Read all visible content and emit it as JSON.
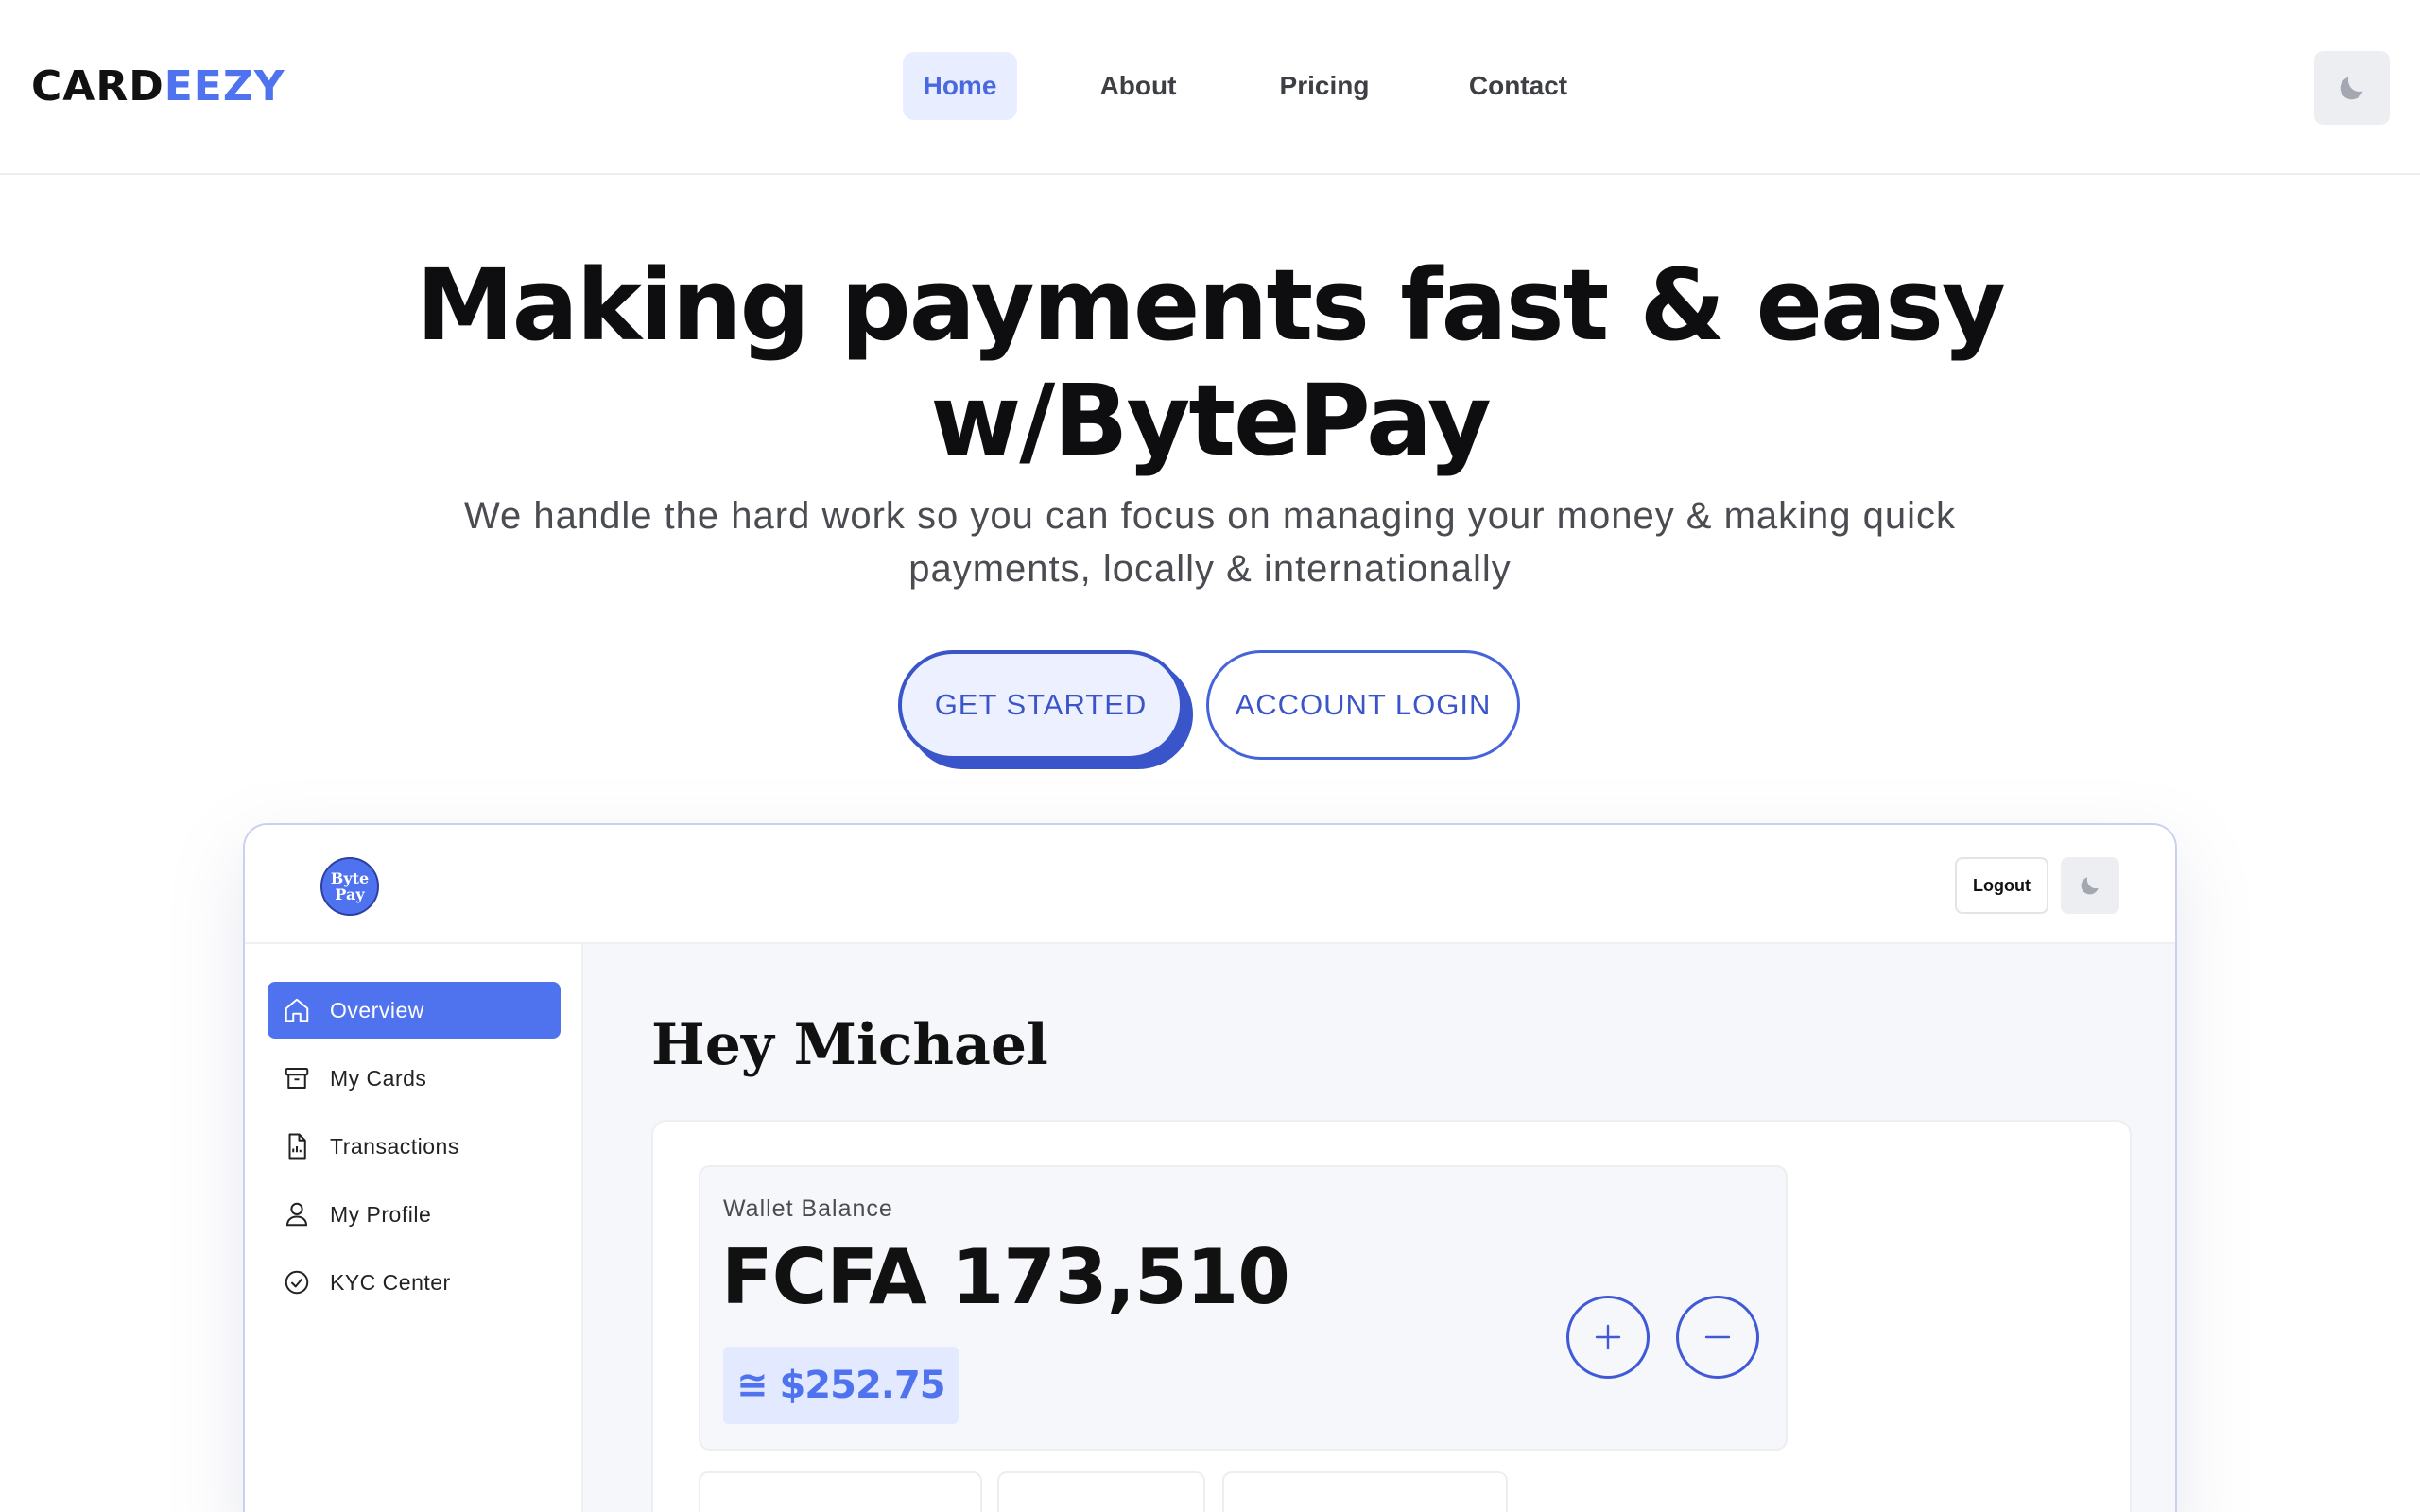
{
  "brand": {
    "part1": "CARD",
    "part2": "EEZY",
    "accent": "#4f72ef"
  },
  "nav": {
    "items": [
      {
        "label": "Home",
        "active": true
      },
      {
        "label": "About",
        "active": false
      },
      {
        "label": "Pricing",
        "active": false
      },
      {
        "label": "Contact",
        "active": false
      }
    ],
    "theme_icon": "moon-icon"
  },
  "hero": {
    "title_line1": "Making payments fast & easy",
    "title_line2": "w/BytePay",
    "subtitle_line1": "We handle the hard work so you can focus on managing your money & making quick",
    "subtitle_line2": "payments, locally & internationally",
    "cta_primary": "GET STARTED",
    "cta_secondary": "ACCOUNT LOGIN"
  },
  "app": {
    "logo_line1": "Byte",
    "logo_line2": "Pay",
    "logout_label": "Logout",
    "sidebar": [
      {
        "label": "Overview",
        "icon": "home-icon",
        "active": true
      },
      {
        "label": "My Cards",
        "icon": "card-box-icon",
        "active": false
      },
      {
        "label": "Transactions",
        "icon": "document-icon",
        "active": false
      },
      {
        "label": "My Profile",
        "icon": "user-icon",
        "active": false
      },
      {
        "label": "KYC Center",
        "icon": "check-circle-icon",
        "active": false
      }
    ],
    "greeting": "Hey Michael",
    "wallet": {
      "label": "Wallet Balance",
      "amount": "FCFA 173,510",
      "usd_equiv": "≅ $252.75"
    },
    "actions": {
      "add_icon": "plus-icon",
      "withdraw_icon": "minus-icon"
    }
  }
}
